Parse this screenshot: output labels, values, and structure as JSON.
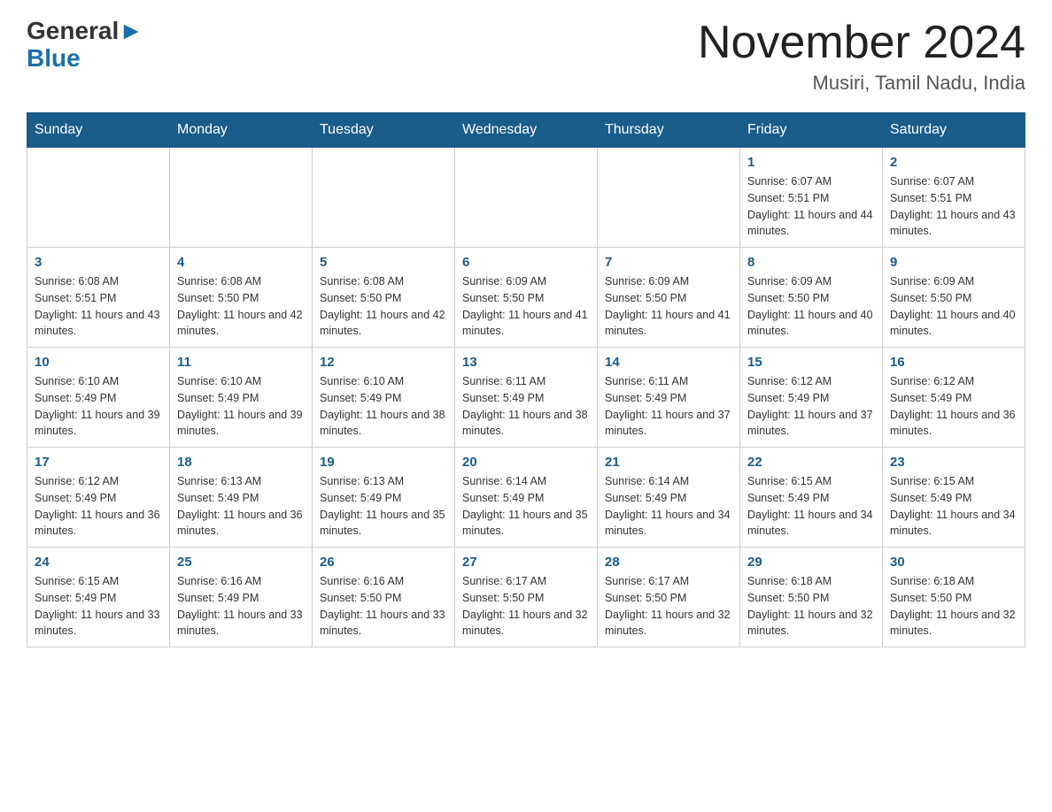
{
  "header": {
    "logo_general": "General",
    "logo_blue": "Blue",
    "month_title": "November 2024",
    "location": "Musiri, Tamil Nadu, India"
  },
  "weekdays": [
    "Sunday",
    "Monday",
    "Tuesday",
    "Wednesday",
    "Thursday",
    "Friday",
    "Saturday"
  ],
  "weeks": [
    [
      {
        "day": "",
        "sunrise": "",
        "sunset": "",
        "daylight": ""
      },
      {
        "day": "",
        "sunrise": "",
        "sunset": "",
        "daylight": ""
      },
      {
        "day": "",
        "sunrise": "",
        "sunset": "",
        "daylight": ""
      },
      {
        "day": "",
        "sunrise": "",
        "sunset": "",
        "daylight": ""
      },
      {
        "day": "",
        "sunrise": "",
        "sunset": "",
        "daylight": ""
      },
      {
        "day": "1",
        "sunrise": "Sunrise: 6:07 AM",
        "sunset": "Sunset: 5:51 PM",
        "daylight": "Daylight: 11 hours and 44 minutes."
      },
      {
        "day": "2",
        "sunrise": "Sunrise: 6:07 AM",
        "sunset": "Sunset: 5:51 PM",
        "daylight": "Daylight: 11 hours and 43 minutes."
      }
    ],
    [
      {
        "day": "3",
        "sunrise": "Sunrise: 6:08 AM",
        "sunset": "Sunset: 5:51 PM",
        "daylight": "Daylight: 11 hours and 43 minutes."
      },
      {
        "day": "4",
        "sunrise": "Sunrise: 6:08 AM",
        "sunset": "Sunset: 5:50 PM",
        "daylight": "Daylight: 11 hours and 42 minutes."
      },
      {
        "day": "5",
        "sunrise": "Sunrise: 6:08 AM",
        "sunset": "Sunset: 5:50 PM",
        "daylight": "Daylight: 11 hours and 42 minutes."
      },
      {
        "day": "6",
        "sunrise": "Sunrise: 6:09 AM",
        "sunset": "Sunset: 5:50 PM",
        "daylight": "Daylight: 11 hours and 41 minutes."
      },
      {
        "day": "7",
        "sunrise": "Sunrise: 6:09 AM",
        "sunset": "Sunset: 5:50 PM",
        "daylight": "Daylight: 11 hours and 41 minutes."
      },
      {
        "day": "8",
        "sunrise": "Sunrise: 6:09 AM",
        "sunset": "Sunset: 5:50 PM",
        "daylight": "Daylight: 11 hours and 40 minutes."
      },
      {
        "day": "9",
        "sunrise": "Sunrise: 6:09 AM",
        "sunset": "Sunset: 5:50 PM",
        "daylight": "Daylight: 11 hours and 40 minutes."
      }
    ],
    [
      {
        "day": "10",
        "sunrise": "Sunrise: 6:10 AM",
        "sunset": "Sunset: 5:49 PM",
        "daylight": "Daylight: 11 hours and 39 minutes."
      },
      {
        "day": "11",
        "sunrise": "Sunrise: 6:10 AM",
        "sunset": "Sunset: 5:49 PM",
        "daylight": "Daylight: 11 hours and 39 minutes."
      },
      {
        "day": "12",
        "sunrise": "Sunrise: 6:10 AM",
        "sunset": "Sunset: 5:49 PM",
        "daylight": "Daylight: 11 hours and 38 minutes."
      },
      {
        "day": "13",
        "sunrise": "Sunrise: 6:11 AM",
        "sunset": "Sunset: 5:49 PM",
        "daylight": "Daylight: 11 hours and 38 minutes."
      },
      {
        "day": "14",
        "sunrise": "Sunrise: 6:11 AM",
        "sunset": "Sunset: 5:49 PM",
        "daylight": "Daylight: 11 hours and 37 minutes."
      },
      {
        "day": "15",
        "sunrise": "Sunrise: 6:12 AM",
        "sunset": "Sunset: 5:49 PM",
        "daylight": "Daylight: 11 hours and 37 minutes."
      },
      {
        "day": "16",
        "sunrise": "Sunrise: 6:12 AM",
        "sunset": "Sunset: 5:49 PM",
        "daylight": "Daylight: 11 hours and 36 minutes."
      }
    ],
    [
      {
        "day": "17",
        "sunrise": "Sunrise: 6:12 AM",
        "sunset": "Sunset: 5:49 PM",
        "daylight": "Daylight: 11 hours and 36 minutes."
      },
      {
        "day": "18",
        "sunrise": "Sunrise: 6:13 AM",
        "sunset": "Sunset: 5:49 PM",
        "daylight": "Daylight: 11 hours and 36 minutes."
      },
      {
        "day": "19",
        "sunrise": "Sunrise: 6:13 AM",
        "sunset": "Sunset: 5:49 PM",
        "daylight": "Daylight: 11 hours and 35 minutes."
      },
      {
        "day": "20",
        "sunrise": "Sunrise: 6:14 AM",
        "sunset": "Sunset: 5:49 PM",
        "daylight": "Daylight: 11 hours and 35 minutes."
      },
      {
        "day": "21",
        "sunrise": "Sunrise: 6:14 AM",
        "sunset": "Sunset: 5:49 PM",
        "daylight": "Daylight: 11 hours and 34 minutes."
      },
      {
        "day": "22",
        "sunrise": "Sunrise: 6:15 AM",
        "sunset": "Sunset: 5:49 PM",
        "daylight": "Daylight: 11 hours and 34 minutes."
      },
      {
        "day": "23",
        "sunrise": "Sunrise: 6:15 AM",
        "sunset": "Sunset: 5:49 PM",
        "daylight": "Daylight: 11 hours and 34 minutes."
      }
    ],
    [
      {
        "day": "24",
        "sunrise": "Sunrise: 6:15 AM",
        "sunset": "Sunset: 5:49 PM",
        "daylight": "Daylight: 11 hours and 33 minutes."
      },
      {
        "day": "25",
        "sunrise": "Sunrise: 6:16 AM",
        "sunset": "Sunset: 5:49 PM",
        "daylight": "Daylight: 11 hours and 33 minutes."
      },
      {
        "day": "26",
        "sunrise": "Sunrise: 6:16 AM",
        "sunset": "Sunset: 5:50 PM",
        "daylight": "Daylight: 11 hours and 33 minutes."
      },
      {
        "day": "27",
        "sunrise": "Sunrise: 6:17 AM",
        "sunset": "Sunset: 5:50 PM",
        "daylight": "Daylight: 11 hours and 32 minutes."
      },
      {
        "day": "28",
        "sunrise": "Sunrise: 6:17 AM",
        "sunset": "Sunset: 5:50 PM",
        "daylight": "Daylight: 11 hours and 32 minutes."
      },
      {
        "day": "29",
        "sunrise": "Sunrise: 6:18 AM",
        "sunset": "Sunset: 5:50 PM",
        "daylight": "Daylight: 11 hours and 32 minutes."
      },
      {
        "day": "30",
        "sunrise": "Sunrise: 6:18 AM",
        "sunset": "Sunset: 5:50 PM",
        "daylight": "Daylight: 11 hours and 32 minutes."
      }
    ]
  ]
}
